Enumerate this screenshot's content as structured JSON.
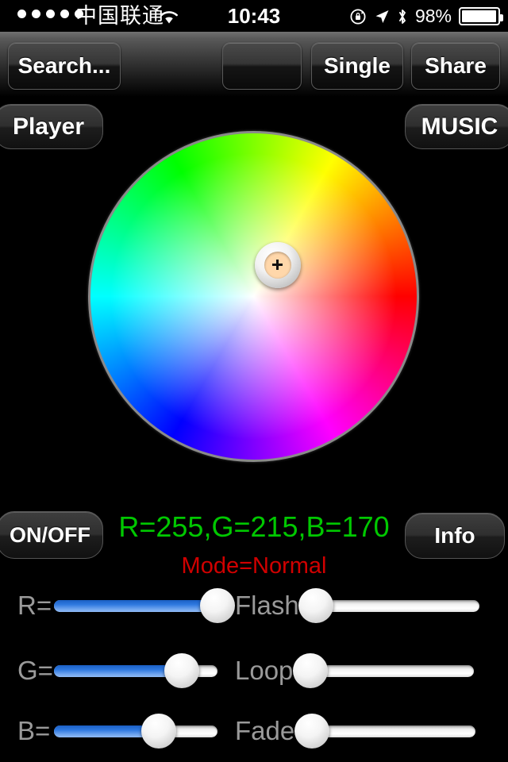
{
  "status_bar": {
    "signal_dots": 5,
    "carrier": "中国联通",
    "wifi_icon": "wifi-icon",
    "time": "10:43",
    "rotation_lock_icon": "rotation-lock-icon",
    "location_icon": "location-arrow-icon",
    "bluetooth_icon": "bluetooth-icon",
    "battery_percent": "98%",
    "battery_level": 98
  },
  "toolbar": {
    "search_label": "Search...",
    "blank_label": "",
    "single_label": "Single",
    "share_label": "Share",
    "player_label": "Player",
    "music_label": "MUSIC"
  },
  "color_wheel": {
    "selected_color": "#FFD7AA",
    "handle_icon": "crosshair-icon",
    "handle_x_pct": 57.3,
    "handle_y_pct": 40.5
  },
  "controls": {
    "onoff_label": "ON/OFF",
    "info_label": "Info",
    "rgb_readout": "R=255,G=215,B=170",
    "rgb_color": "#00c800",
    "mode_readout": "Mode=Normal",
    "mode_color": "#d00000"
  },
  "sliders": {
    "fill_color": "#2f79e0",
    "left": [
      {
        "label": "R=",
        "value": 255,
        "max": 255,
        "percent": 100
      },
      {
        "label": "G=",
        "value": 215,
        "max": 255,
        "percent": 78
      },
      {
        "label": "B=",
        "value": 170,
        "max": 255,
        "percent": 64
      }
    ],
    "right": [
      {
        "label": "Flash=",
        "value": 0,
        "max": 255,
        "percent": 0
      },
      {
        "label": "Loop=",
        "value": 0,
        "max": 255,
        "percent": 0
      },
      {
        "label": "Fade=",
        "value": 0,
        "max": 255,
        "percent": 0
      }
    ]
  }
}
